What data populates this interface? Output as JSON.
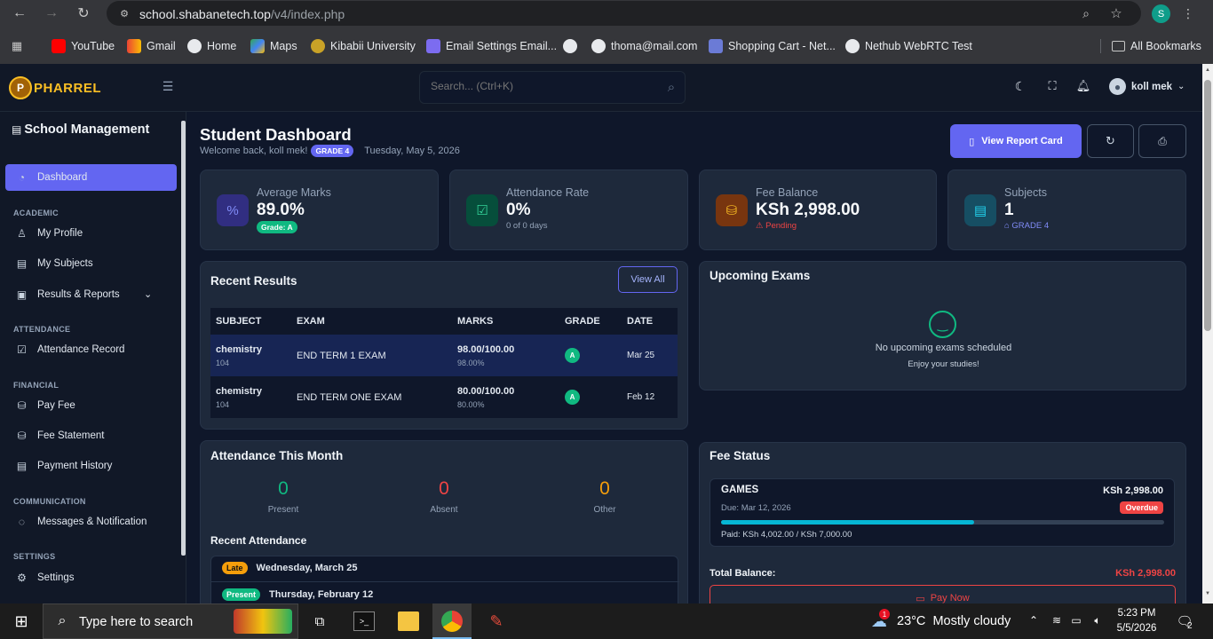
{
  "browser": {
    "url_host": "school.shabanetech.top",
    "url_path": "/v4/index.php",
    "profile_initial": "S",
    "bookmarks": [
      "YouTube",
      "Gmail",
      "Home",
      "Maps",
      "Kibabii University",
      "Email Settings Email...",
      "",
      "thoma@mail.com",
      "Shopping Cart - Net...",
      "Nethub WebRTC Test"
    ],
    "all_bookmarks": "All Bookmarks"
  },
  "topbar": {
    "logo_mark": "P",
    "logo_text": "PHARREL",
    "search_placeholder": "Search... (Ctrl+K)",
    "user_name": "koll mek"
  },
  "sidebar": {
    "title": "School Management",
    "dashboard": "Dashboard",
    "sections": {
      "academic": "ACADEMIC",
      "attendance": "ATTENDANCE",
      "financial": "FINANCIAL",
      "communication": "COMMUNICATION",
      "settings": "SETTINGS"
    },
    "items": {
      "profile": "My Profile",
      "subjects": "My Subjects",
      "results": "Results & Reports",
      "attendance_record": "Attendance Record",
      "pay_fee": "Pay Fee",
      "fee_statement": "Fee Statement",
      "payment_history": "Payment History",
      "messages": "Messages & Notification",
      "settings": "Settings"
    }
  },
  "header": {
    "title": "Student Dashboard",
    "welcome": "Welcome back, koll mek!",
    "grade_badge": "GRADE 4",
    "date": "Tuesday, May 5, 2026",
    "view_report_card": "View Report Card"
  },
  "stats": [
    {
      "label": "Average Marks",
      "value": "89.0%",
      "sub": "Grade: A"
    },
    {
      "label": "Attendance Rate",
      "value": "0%",
      "sub": "0 of 0 days"
    },
    {
      "label": "Fee Balance",
      "value": "KSh 2,998.00",
      "sub": "Pending"
    },
    {
      "label": "Subjects",
      "value": "1",
      "sub": "GRADE 4"
    }
  ],
  "recent_results": {
    "title": "Recent Results",
    "view_all": "View All",
    "columns": [
      "SUBJECT",
      "EXAM",
      "MARKS",
      "GRADE",
      "DATE"
    ],
    "rows": [
      {
        "subject": "chemistry",
        "code": "104",
        "exam": "END TERM 1 EXAM",
        "marks": "98.00/100.00",
        "pct": "98.00%",
        "grade": "A",
        "date": "Mar 25"
      },
      {
        "subject": "chemistry",
        "code": "104",
        "exam": "END TERM ONE EXAM",
        "marks": "80.00/100.00",
        "pct": "80.00%",
        "grade": "A",
        "date": "Feb 12"
      }
    ]
  },
  "upcoming_exams": {
    "title": "Upcoming Exams",
    "empty": "No upcoming exams scheduled",
    "empty_sub": "Enjoy your studies!"
  },
  "attendance_month": {
    "title": "Attendance This Month",
    "present": "0",
    "present_label": "Present",
    "absent": "0",
    "absent_label": "Absent",
    "other": "0",
    "other_label": "Other",
    "recent_title": "Recent Attendance",
    "recent": [
      {
        "status": "Late",
        "date": "Wednesday, March 25"
      },
      {
        "status": "Present",
        "date": "Thursday, February 12"
      }
    ]
  },
  "fee_status": {
    "title": "Fee Status",
    "item_name": "GAMES",
    "item_amount": "KSh 2,998.00",
    "due": "Due: Mar 12, 2026",
    "status": "Overdue",
    "progress": 0.5717,
    "paid": "Paid: KSh 4,002.00 / KSh 7,000.00",
    "total_label": "Total Balance:",
    "total_value": "KSh 2,998.00",
    "pay_now": "Pay Now"
  },
  "taskbar": {
    "search_placeholder": "Type here to search",
    "weather_badge": "1",
    "weather": "23°C  Mostly cloudy",
    "time": "5:23 PM",
    "date": "5/5/2026",
    "notif_count": "2"
  },
  "colors": {
    "accent": "#6366f1",
    "green": "#10b981",
    "red": "#ef4444",
    "amber": "#f59e0b",
    "cyan": "#06b6d4"
  }
}
